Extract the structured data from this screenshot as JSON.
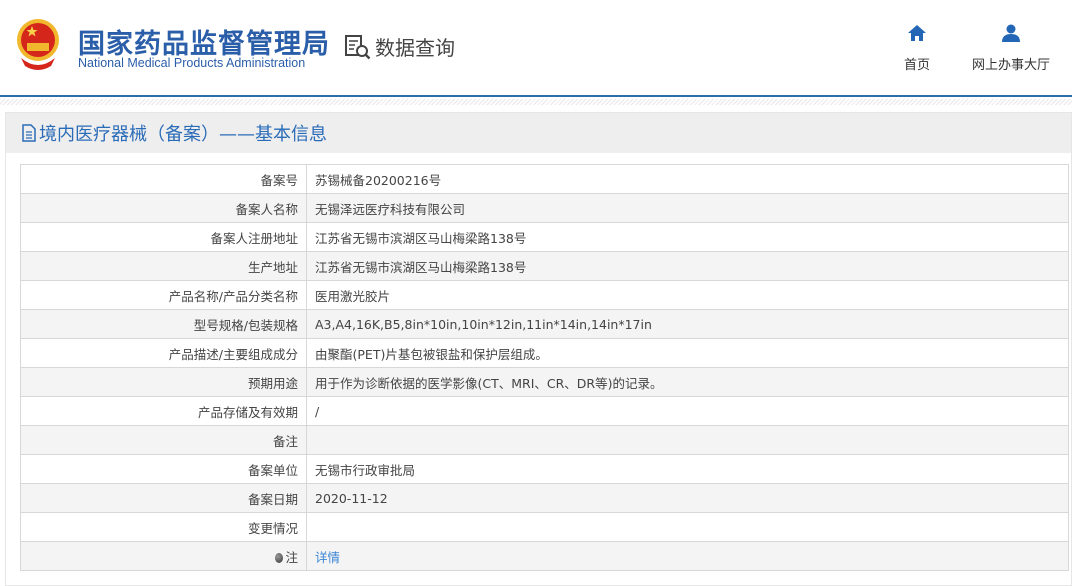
{
  "header": {
    "logo_cn": "国家药品监督管理局",
    "logo_en": "National Medical Products Administration",
    "query_label": "数据查询",
    "nav": [
      {
        "label": "首页",
        "icon": "home-icon"
      },
      {
        "label": "网上办事大厅",
        "icon": "user-icon"
      }
    ]
  },
  "panel": {
    "title": "境内医疗器械（备案）——基本信息"
  },
  "rows": [
    {
      "label": "备案号",
      "value": "苏锡械备20200216号"
    },
    {
      "label": "备案人名称",
      "value": "无锡泽远医疗科技有限公司"
    },
    {
      "label": "备案人注册地址",
      "value": "江苏省无锡市滨湖区马山梅梁路138号"
    },
    {
      "label": "生产地址",
      "value": "江苏省无锡市滨湖区马山梅梁路138号"
    },
    {
      "label": "产品名称/产品分类名称",
      "value": "医用激光胶片"
    },
    {
      "label": "型号规格/包装规格",
      "value": "A3,A4,16K,B5,8in*10in,10in*12in,11in*14in,14in*17in"
    },
    {
      "label": "产品描述/主要组成成分",
      "value": "由聚酯(PET)片基包被银盐和保护层组成。"
    },
    {
      "label": "预期用途",
      "value": "用于作为诊断依据的医学影像(CT、MRI、CR、DR等)的记录。"
    },
    {
      "label": "产品存储及有效期",
      "value": "/"
    },
    {
      "label": "备注",
      "value": ""
    },
    {
      "label": "备案单位",
      "value": "无锡市行政审批局"
    },
    {
      "label": "备案日期",
      "value": "2020-11-12"
    },
    {
      "label": "变更情况",
      "value": ""
    },
    {
      "label": "注",
      "value": "详情"
    }
  ]
}
